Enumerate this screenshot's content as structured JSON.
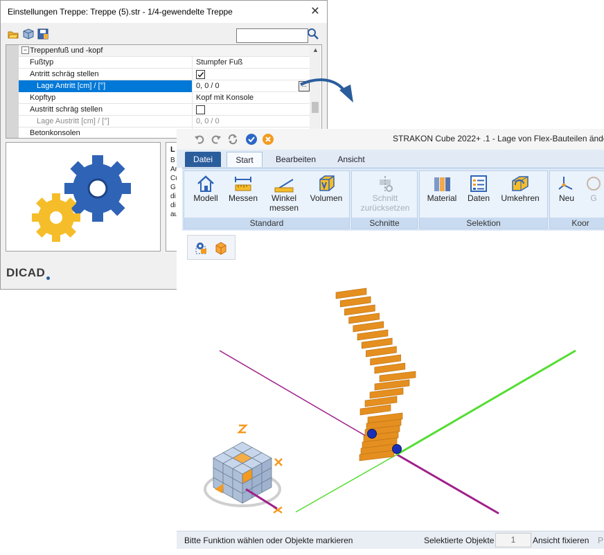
{
  "settings_dialog": {
    "title": "Einstellungen Treppe: Treppe (5).str - 1/4-gewendelte Treppe",
    "close_glyph": "✕",
    "toolbar_icons": [
      "open-folder-icon",
      "cube-icon",
      "save-icon"
    ],
    "search": {
      "value": "",
      "icon": "search-icon"
    },
    "section_label": "Treppenfuß und -kopf",
    "properties": [
      {
        "name": "Fußtyp",
        "value": "Stumpfer Fuß"
      },
      {
        "name": "Antritt schräg stellen",
        "checked": true
      },
      {
        "name": "Lage Antritt [cm] /  [°]",
        "value": "0, 0 / 0",
        "selected": true,
        "ellipsis": "..."
      },
      {
        "name": "Kopftyp",
        "value": "Kopf mit Konsole"
      },
      {
        "name": "Austritt schräg stellen",
        "checked": false
      },
      {
        "name": "Lage Austritt [cm] /  [°]",
        "value": "0, 0 / 0",
        "disabled": true
      },
      {
        "name": "Betonkonsolen",
        "value": ""
      }
    ],
    "description_title": "L",
    "description_lines": [
      "B",
      "Ar",
      "Cu",
      "G",
      "di",
      "di",
      "au"
    ],
    "logo_text": "DICAD"
  },
  "main_window": {
    "title": "STRAKON Cube 2022+ .1 - Lage von Flex-Bauteilen änder",
    "quick_access_icons": [
      "undo-icon",
      "redo-icon",
      "refresh-icon",
      "confirm-icon",
      "cancel-icon"
    ],
    "tabs": [
      "Datei",
      "Start",
      "Bearbeiten",
      "Ansicht"
    ],
    "active_tab": "Start",
    "groups": [
      {
        "caption": "Standard",
        "buttons": [
          {
            "label": "Modell",
            "icon": "house-icon"
          },
          {
            "label": "Messen",
            "icon": "ruler-icon"
          },
          {
            "label": "Winkel messen",
            "icon": "angle-measure-icon"
          },
          {
            "label": "Volumen",
            "icon": "volume-icon"
          }
        ]
      },
      {
        "caption": "Schnitte",
        "buttons": [
          {
            "label": "Schnitt zurücksetzen",
            "icon": "section-reset-icon",
            "disabled": true
          }
        ]
      },
      {
        "caption": "Selektion",
        "buttons": [
          {
            "label": "Material",
            "icon": "material-icon"
          },
          {
            "label": "Daten",
            "icon": "data-icon"
          },
          {
            "label": "Umkehren",
            "icon": "invert-selection-icon"
          }
        ]
      },
      {
        "caption": "Koor",
        "buttons": [
          {
            "label": "Neu",
            "icon": "axes-new-icon"
          },
          {
            "label": "G",
            "icon": "globe-icon"
          }
        ]
      }
    ],
    "view_toolbar_icons": [
      "visibility-icon",
      "box-icon"
    ],
    "status": {
      "message": "Bitte Funktion wählen oder Objekte markieren",
      "selected_label": "Selektierte Objekte",
      "selected_count": "1",
      "fix_view": "Ansicht fixieren",
      "extra": "P"
    }
  },
  "colors": {
    "accent_blue": "#0078d7",
    "ribbon_blue": "#2a5d9c",
    "stair_orange": "#f2a63c",
    "axis_green": "#55dd33",
    "axis_purple": "#a0208a"
  }
}
